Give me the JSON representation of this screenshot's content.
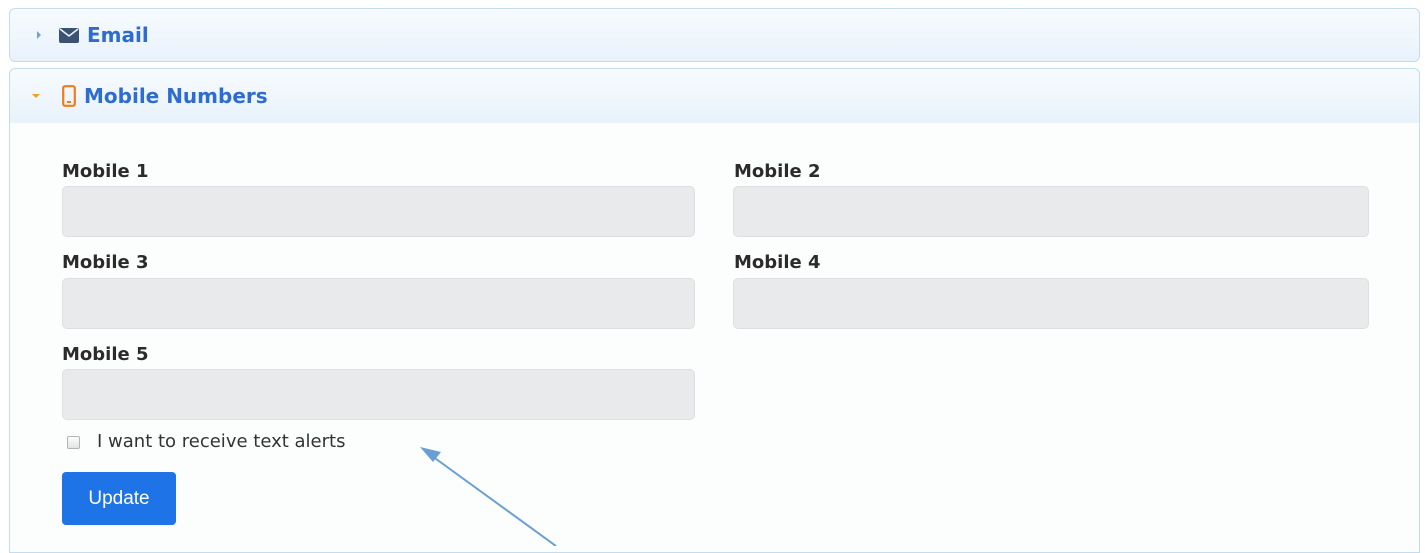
{
  "accordion": {
    "email": {
      "title": "Email",
      "icon": "envelope-icon",
      "expanded": false
    },
    "mobile": {
      "title": "Mobile Numbers",
      "icon": "mobile-phone-icon",
      "expanded": true
    }
  },
  "form": {
    "fields": [
      {
        "label": "Mobile 1",
        "value": ""
      },
      {
        "label": "Mobile 2",
        "value": ""
      },
      {
        "label": "Mobile 3",
        "value": ""
      },
      {
        "label": "Mobile 4",
        "value": ""
      },
      {
        "label": "Mobile 5",
        "value": ""
      }
    ],
    "text_alerts": {
      "label": "I want to receive text alerts",
      "checked": false
    },
    "update_label": "Update"
  },
  "colors": {
    "title": "#2d6cd1",
    "button": "#1e73e6",
    "expanded_accent": "#f0a020",
    "annotation_arrow": "#6a9fd4"
  }
}
